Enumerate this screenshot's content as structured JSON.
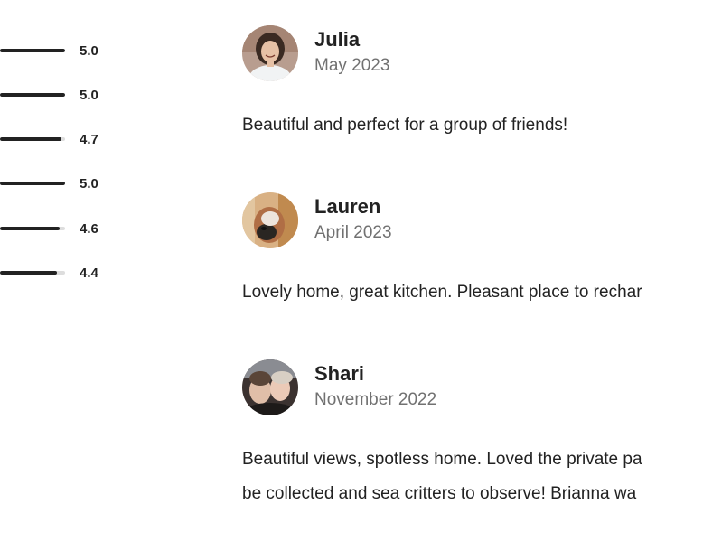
{
  "ratings": [
    {
      "value": 5.0,
      "label": "5.0"
    },
    {
      "value": 5.0,
      "label": "5.0"
    },
    {
      "value": 4.7,
      "label": "4.7"
    },
    {
      "value": 5.0,
      "label": "5.0"
    },
    {
      "value": 4.6,
      "label": "4.6"
    },
    {
      "value": 4.4,
      "label": "4.4"
    }
  ],
  "rating_max": 5.0,
  "colors": {
    "bar_fill": "#222222",
    "bar_track": "#dddddd",
    "text": "#222222",
    "muted": "#717171"
  },
  "reviews": [
    {
      "name": "Julia",
      "date": "May 2023",
      "avatar": "woman-curly-hair-avatar",
      "lines": [
        "Beautiful and perfect for a group of friends!"
      ]
    },
    {
      "name": "Lauren",
      "date": "April 2023",
      "avatar": "dog-avatar",
      "lines": [
        "Lovely home, great kitchen. Pleasant place to rechar"
      ]
    },
    {
      "name": "Shari",
      "date": "November 2022",
      "avatar": "couple-avatar",
      "lines": [
        "Beautiful views, spotless home. Loved the private pa",
        "be collected and sea critters to observe! Brianna wa"
      ]
    }
  ]
}
